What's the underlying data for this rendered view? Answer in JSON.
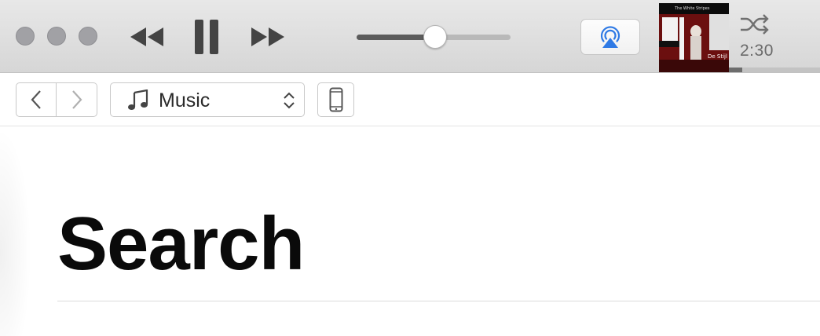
{
  "player": {
    "elapsed_time": "2:30",
    "volume_level": 0.51,
    "track_progress": 0.15,
    "album_art": {
      "small_text": "The White Stripes",
      "brand_text": "De Stijl"
    }
  },
  "toolbar": {
    "media_type": "Music"
  },
  "main": {
    "title": "Search"
  },
  "icons": {
    "window_controls": [
      "close-icon",
      "minimize-icon",
      "zoom-icon"
    ],
    "playback": [
      "rewind-icon",
      "pause-icon",
      "fast-forward-icon"
    ],
    "airplay": "airplay-icon",
    "shuffle": "shuffle-icon",
    "navigation": [
      "chevron-left-icon",
      "chevron-right-icon"
    ],
    "media_menu": [
      "music-note-icon",
      "up-down-chevron-icon"
    ],
    "device": "iphone-icon"
  },
  "colors": {
    "airplay_accent": "#2f7ae5",
    "title_text": "#0a0a0a",
    "window_buttons": "#a1a1a5"
  }
}
